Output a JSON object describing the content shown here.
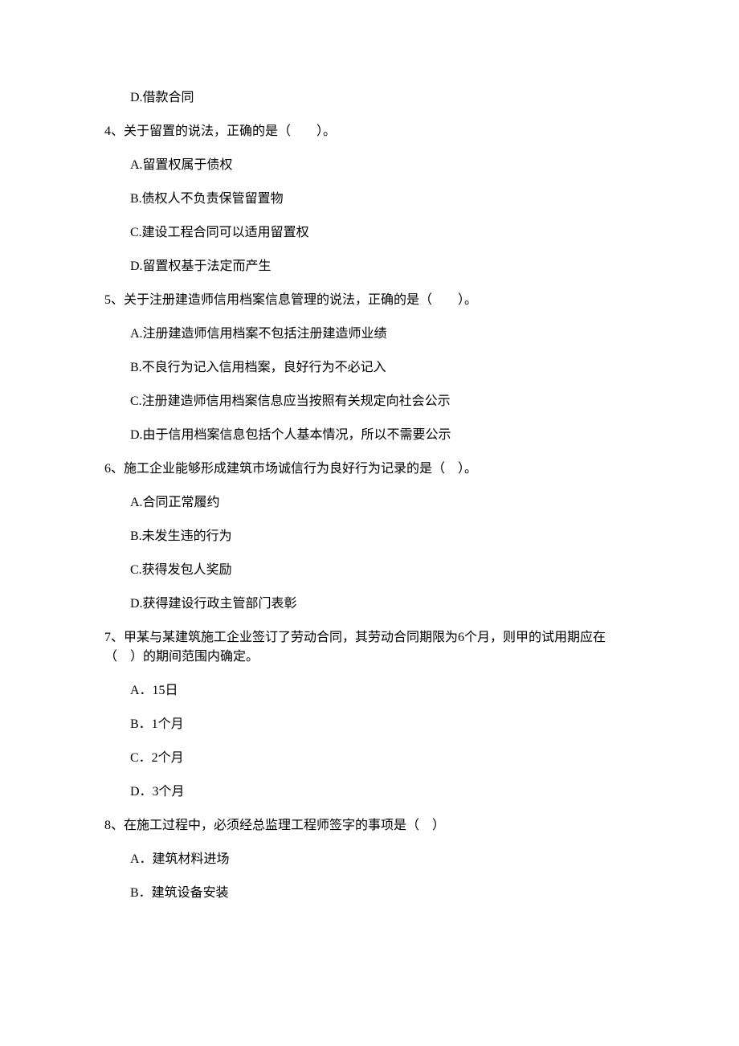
{
  "orphan_option": {
    "label": "D.借款合同"
  },
  "questions": [
    {
      "stem": "4、关于留置的说法，正确的是（　　）。",
      "options": [
        "A.留置权属于债权",
        "B.债权人不负责保管留置物",
        "C.建设工程合同可以适用留置权",
        "D.留置权基于法定而产生"
      ]
    },
    {
      "stem": "5、关于注册建造师信用档案信息管理的说法，正确的是（　　）。",
      "options": [
        "A.注册建造师信用档案不包括注册建造师业绩",
        "B.不良行为记入信用档案，良好行为不必记入",
        "C.注册建造师信用档案信息应当按照有关规定向社会公示",
        "D.由于信用档案信息包括个人基本情况，所以不需要公示"
      ]
    },
    {
      "stem": "6、施工企业能够形成建筑市场诚信行为良好行为记录的是（　）。",
      "options": [
        "A.合同正常履约",
        "B.未发生违的行为",
        "C.获得发包人奖励",
        "D.获得建设行政主管部门表彰"
      ]
    },
    {
      "stem_lines": [
        "7、甲某与某建筑施工企业签订了劳动合同，其劳动合同期限为6个月，则甲的试用期应在",
        "（　）的期间范围内确定。"
      ],
      "options": [
        "A．15日",
        "B．1个月",
        "C．2个月",
        "D．3个月"
      ]
    },
    {
      "stem": "8、在施工过程中，必须经总监理工程师签字的事项是（　）",
      "options": [
        "A．建筑材料进场",
        "B．建筑设备安装"
      ]
    }
  ]
}
